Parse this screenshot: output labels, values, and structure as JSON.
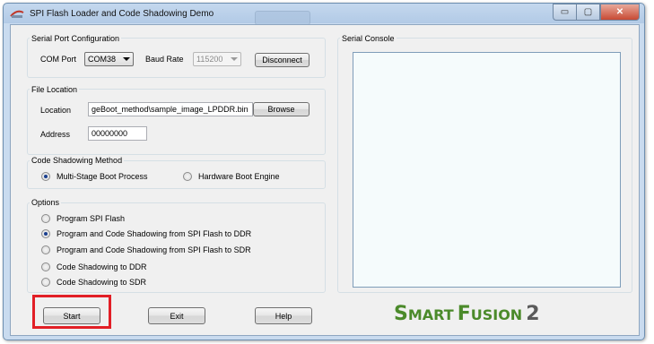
{
  "window": {
    "title": "SPI Flash Loader and Code Shadowing Demo"
  },
  "window_controls": {
    "minimize": "▭",
    "maximize": "▢",
    "close": "✕"
  },
  "serial_port": {
    "group_label": "Serial Port Configuration",
    "com_port_label": "COM Port",
    "com_port_value": "COM38",
    "baud_rate_label": "Baud Rate",
    "baud_rate_value": "115200",
    "disconnect_label": "Disconnect"
  },
  "file_location": {
    "group_label": "File Location",
    "location_label": "Location",
    "location_value": "geBoot_method\\sample_image_LPDDR.bin",
    "browse_label": "Browse",
    "address_label": "Address",
    "address_value": "00000000"
  },
  "code_shadowing": {
    "group_label": "Code Shadowing Method",
    "options": [
      {
        "label": "Multi-Stage Boot Process",
        "checked": true
      },
      {
        "label": "Hardware Boot Engine",
        "checked": false
      }
    ]
  },
  "options": {
    "group_label": "Options",
    "items": [
      {
        "label": "Program SPI Flash",
        "checked": false
      },
      {
        "label": "Program and Code Shadowing from SPI Flash to DDR",
        "checked": true
      },
      {
        "label": "Program and Code Shadowing from SPI Flash to SDR",
        "checked": false
      },
      {
        "label": "Code Shadowing to DDR",
        "checked": false
      },
      {
        "label": "Code Shadowing to SDR",
        "checked": false
      }
    ]
  },
  "serial_console": {
    "label": "Serial Console"
  },
  "buttons": {
    "start": "Start",
    "exit": "Exit",
    "help": "Help"
  },
  "logo": {
    "part1_big": "S",
    "part1_small": "MART",
    "part2_big": "F",
    "part2_small": "USION",
    "number": "2"
  },
  "colors": {
    "highlight": "#e21f26",
    "logo_green": "#4b8a2a",
    "radio_dot": "#1a3f8e"
  }
}
